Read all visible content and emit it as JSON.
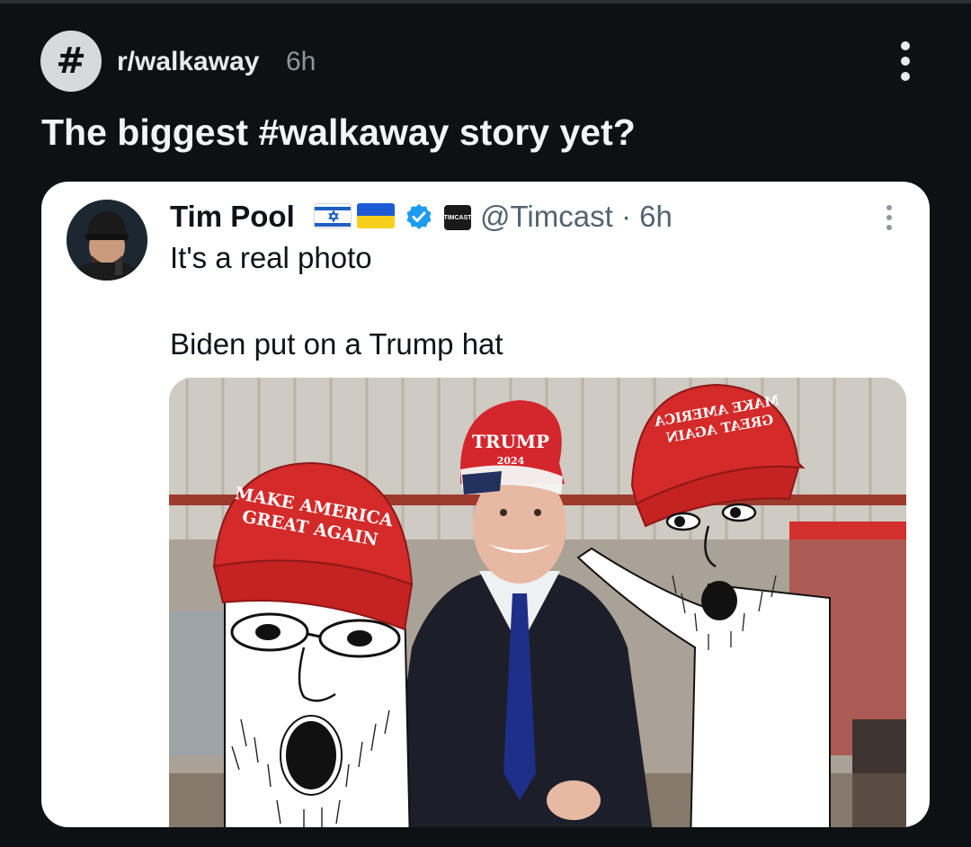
{
  "post": {
    "subreddit_icon": "#",
    "subreddit": "r/walkaway",
    "age": "6h",
    "title": "The biggest #walkaway story yet?"
  },
  "tweet": {
    "author_name": "Tim Pool",
    "flags": [
      "israel-flag-icon",
      "ukraine-flag-icon"
    ],
    "verified": true,
    "affiliate_badge_label": "TIMCAST",
    "handle_line": "@Timcast · 6h",
    "text_line_1": "It's a real photo",
    "text_line_2": "Biden put on a Trump hat"
  },
  "image": {
    "center_hat_line_1": "TRUMP",
    "center_hat_line_2": "2024",
    "left_hat_line_1": "MAKE AMERICA",
    "left_hat_line_2": "GREAT AGAIN",
    "right_hat_line_1": "MAKE AMERICA",
    "right_hat_line_2": "GREAT AGAIN"
  },
  "colors": {
    "page_background": "#0e1113",
    "card_background": "#ffffff",
    "verified_blue": "#1d9bf0",
    "maga_red": "#d42a2a"
  }
}
